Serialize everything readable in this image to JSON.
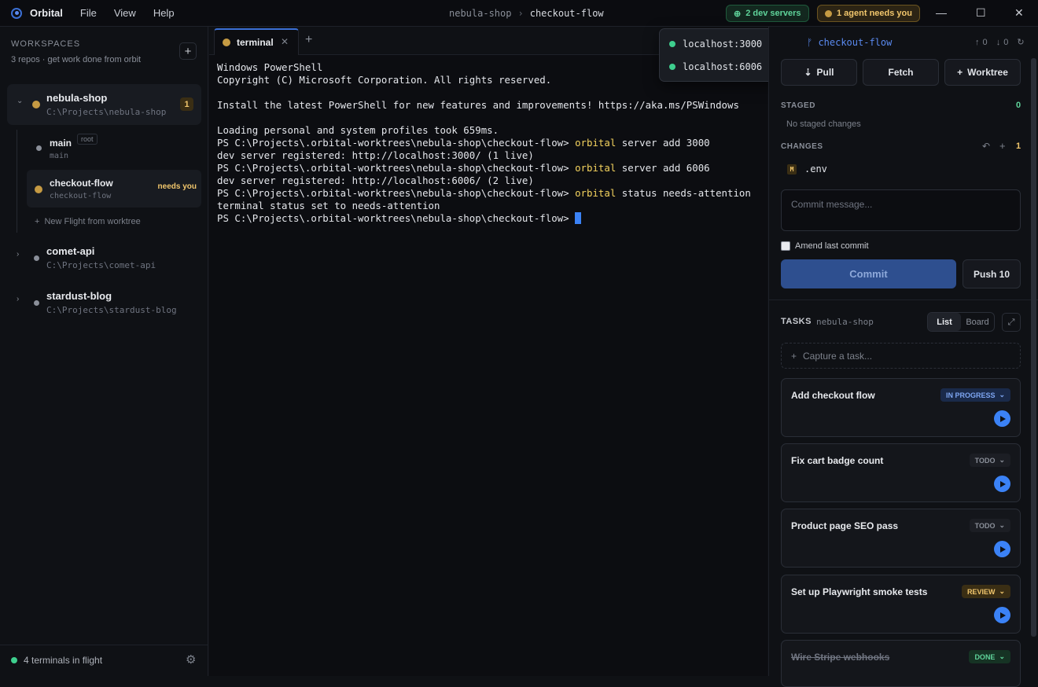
{
  "app": {
    "name": "Orbital",
    "menus": [
      "File",
      "View",
      "Help"
    ]
  },
  "breadcrumb": {
    "repo": "nebula-shop",
    "branch": "checkout-flow"
  },
  "pills": {
    "dev_servers": "2 dev servers",
    "agent": "1 agent needs you"
  },
  "colors": {
    "accent": "#3b6fd4",
    "live": "#3ecf8e",
    "attention": "#f1c66c"
  },
  "sidebar": {
    "heading": "WORKSPACES",
    "subtitle": "3 repos · get work done from orbit",
    "repos": [
      {
        "name": "nebula-shop",
        "path": "C:\\Projects\\nebula-shop",
        "badge": "1",
        "worktrees": [
          {
            "name": "main",
            "path": "main",
            "tag": "root"
          },
          {
            "name": "checkout-flow",
            "path": "checkout-flow",
            "status": "needs you"
          }
        ],
        "new_flight": "New Flight from worktree"
      },
      {
        "name": "comet-api",
        "path": "C:\\Projects\\comet-api"
      },
      {
        "name": "stardust-blog",
        "path": "C:\\Projects\\stardust-blog"
      }
    ],
    "footer": "4 terminals in flight"
  },
  "terminal": {
    "tab_label": "terminal",
    "lines": [
      {
        "text": "Windows PowerShell"
      },
      {
        "text": "Copyright (C) Microsoft Corporation. All rights reserved."
      },
      {
        "text": ""
      },
      {
        "text": "Install the latest PowerShell for new features and improvements! https://aka.ms/PSWindows"
      },
      {
        "text": ""
      },
      {
        "text": "Loading personal and system profiles took 659ms."
      },
      {
        "prompt": "PS C:\\Projects\\.orbital-worktrees\\nebula-shop\\checkout-flow> ",
        "cmd": "orbital",
        "args": " server add 3000"
      },
      {
        "text": "dev server registered: http://localhost:3000/ (1 live)"
      },
      {
        "prompt": "PS C:\\Projects\\.orbital-worktrees\\nebula-shop\\checkout-flow> ",
        "cmd": "orbital",
        "args": " server add 6006"
      },
      {
        "text": "dev server registered: http://localhost:6006/ (2 live)"
      },
      {
        "prompt": "PS C:\\Projects\\.orbital-worktrees\\nebula-shop\\checkout-flow> ",
        "cmd": "orbital",
        "args": " status needs-attention"
      },
      {
        "text": "terminal status set to needs-attention"
      },
      {
        "prompt": "PS C:\\Projects\\.orbital-worktrees\\nebula-shop\\checkout-flow> ",
        "cursor": true
      }
    ]
  },
  "servers_popover": [
    "localhost:3000",
    "localhost:6006"
  ],
  "git": {
    "branch": "checkout-flow",
    "buttons": {
      "pull": "Pull",
      "fetch": "Fetch",
      "worktree": "Worktree"
    },
    "staged_label": "STAGED",
    "staged_count": "0",
    "no_staged": "No staged changes",
    "changes_label": "CHANGES",
    "changes_count": "1",
    "changes": [
      {
        "badge": "M",
        "file": ".env"
      }
    ],
    "commit_placeholder": "Commit message...",
    "amend_label": "Amend last commit",
    "commit_button": "Commit",
    "push_button": "Push 10"
  },
  "tasks": {
    "heading": "TASKS",
    "repo": "nebula-shop",
    "views": [
      "List",
      "Board"
    ],
    "capture_placeholder": "Capture a task...",
    "items": [
      {
        "title": "Add checkout flow",
        "status": "IN PROGRESS"
      },
      {
        "title": "Fix cart badge count",
        "status": "TODO"
      },
      {
        "title": "Product page SEO pass",
        "status": "TODO"
      },
      {
        "title": "Set up Playwright smoke tests",
        "status": "REVIEW"
      },
      {
        "title": "Wire Stripe webhooks",
        "status": "DONE"
      }
    ]
  }
}
